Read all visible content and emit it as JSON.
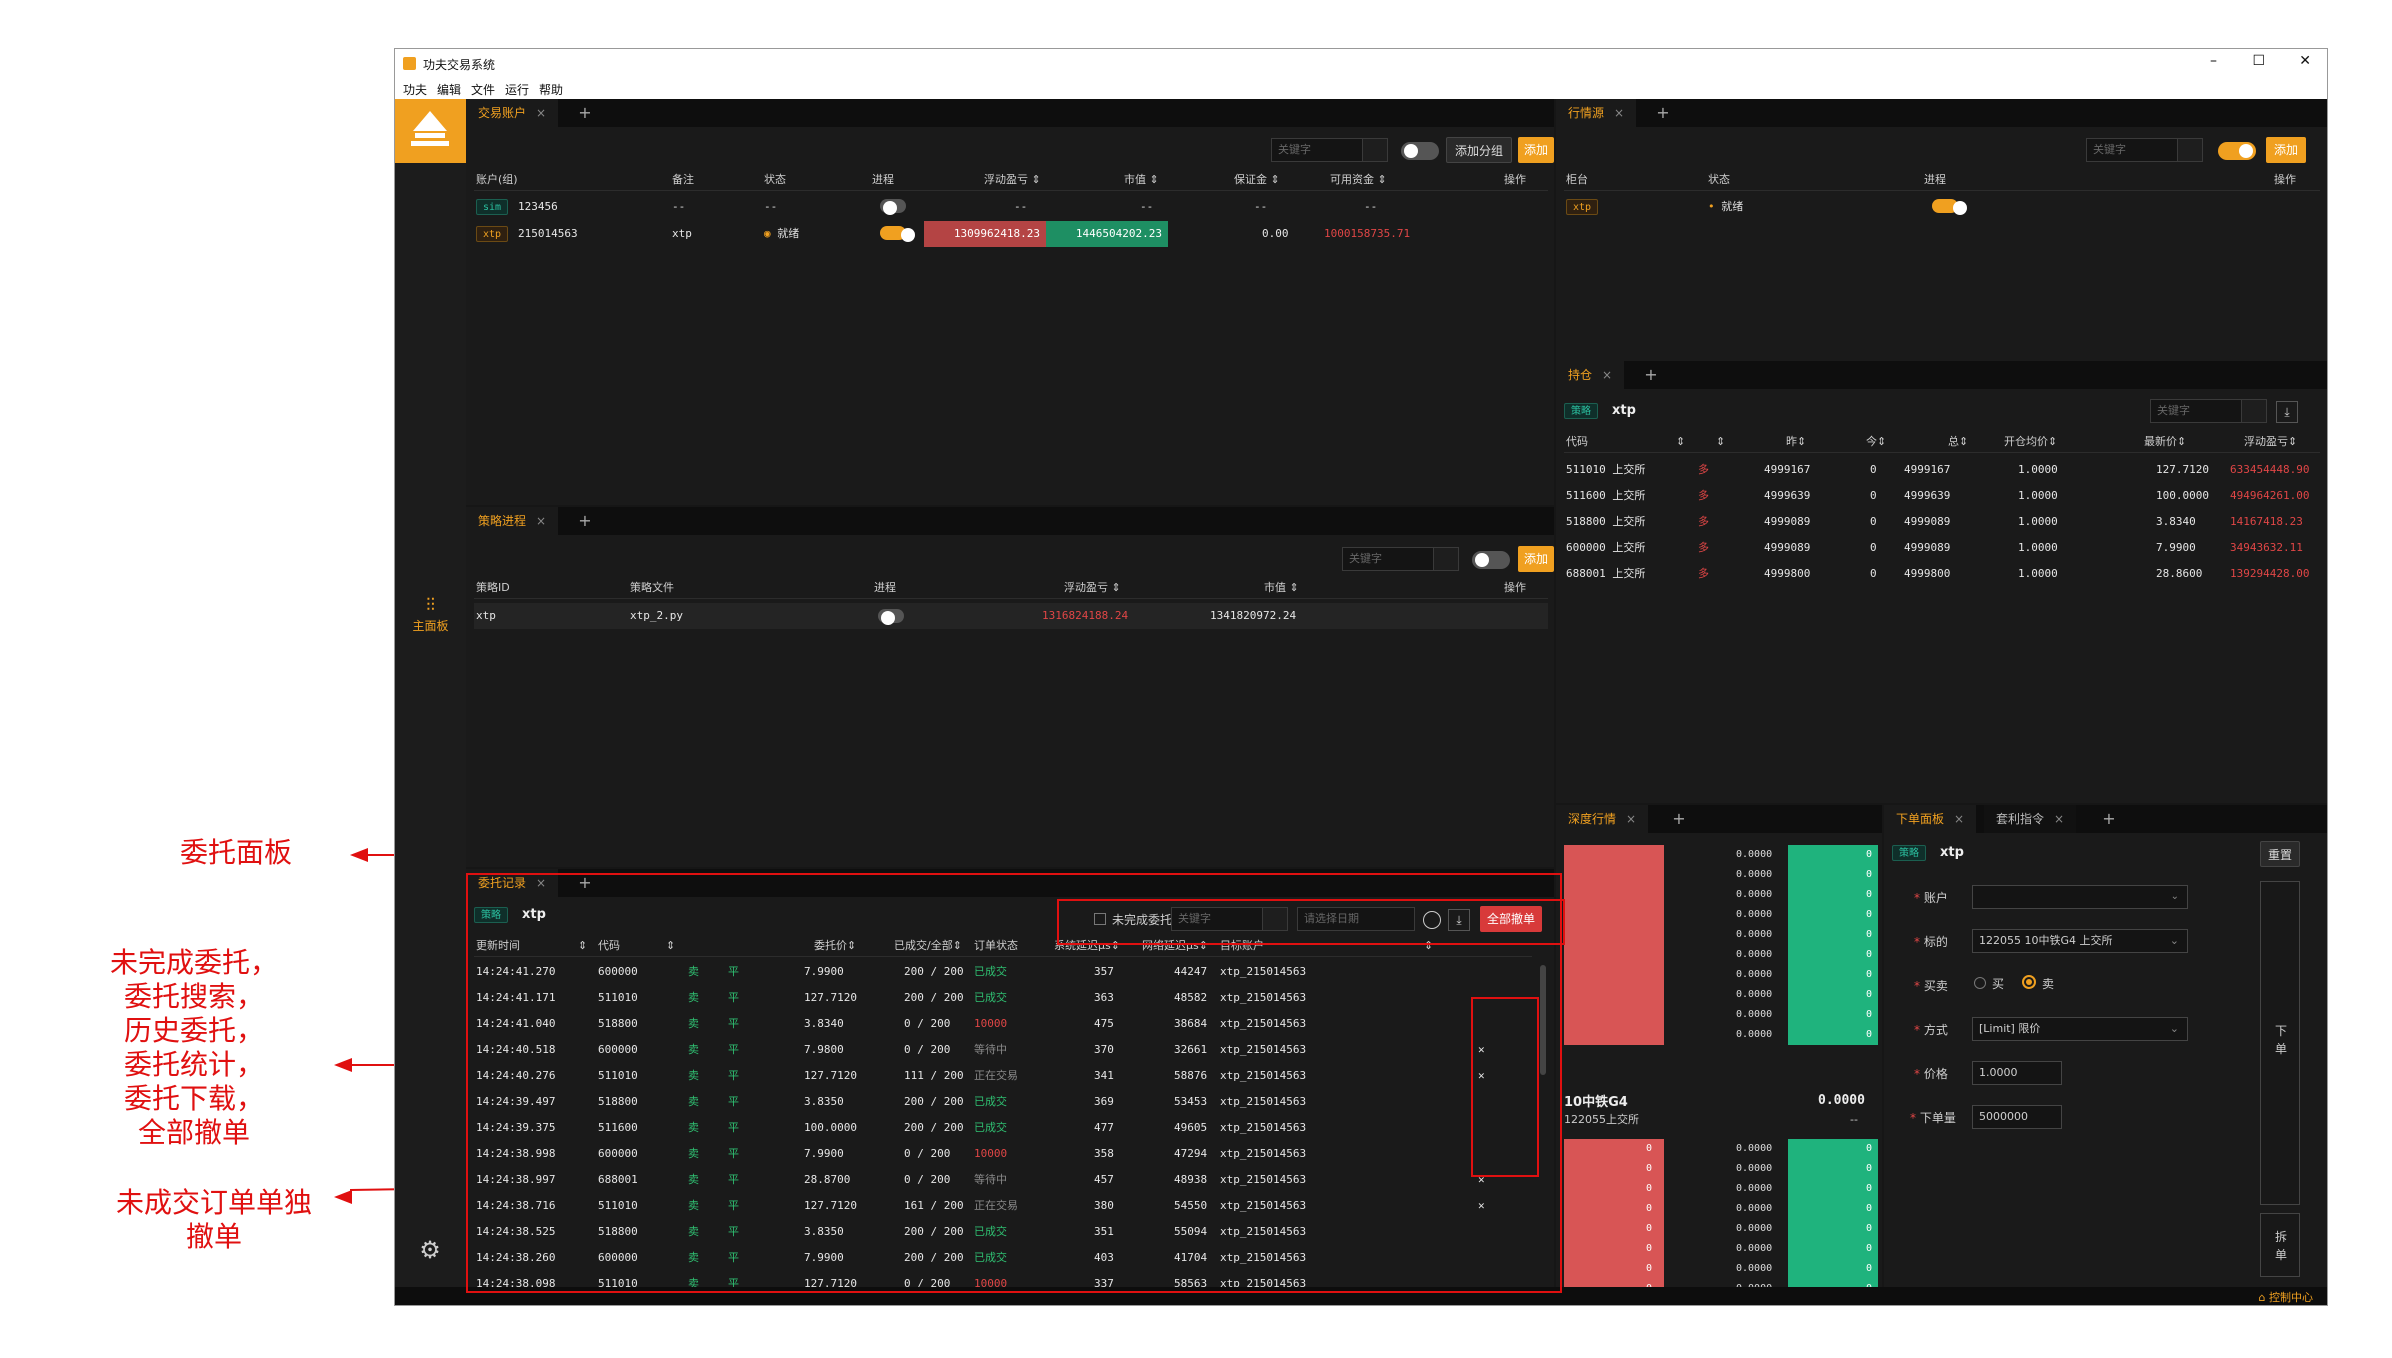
{
  "annotations": {
    "order_panel": "委托面板",
    "functions": [
      "未完成委托，",
      "委托搜索，",
      "历史委托，",
      "委托统计，",
      "委托下载，",
      "全部撤单"
    ],
    "single_cancel": [
      "未成交订单单独",
      "撤单"
    ]
  },
  "window": {
    "title": "功夫交易系统",
    "controls": [
      "–",
      "☐",
      "✕"
    ],
    "menu": [
      "功夫",
      "编辑",
      "文件",
      "运行",
      "帮助"
    ]
  },
  "sidebar": {
    "main_label": "主面板"
  },
  "statusbar": {
    "control_center": "控制中心"
  },
  "accounts": {
    "tab": "交易账户",
    "search_placeholder": "关键字",
    "add_group": "添加分组",
    "add": "添加",
    "headers": [
      "账户(组)",
      "备注",
      "状态",
      "进程",
      "浮动盈亏 ⇕",
      "市值 ⇕",
      "保证金 ⇕",
      "可用资金 ⇕",
      "操作"
    ],
    "rows": [
      {
        "tag": "sim",
        "id": "123456",
        "note": "--",
        "status": "--",
        "pnl": "--",
        "mv": "--",
        "margin": "--",
        "cash": "--"
      },
      {
        "tag": "xtp",
        "id": "215014563",
        "note": "xtp",
        "status": "就绪",
        "pnl": "1309962418.23",
        "mv": "1446504202.23",
        "margin": "0.00",
        "cash": "1000158735.71"
      }
    ]
  },
  "strategies": {
    "tab": "策略进程",
    "search_placeholder": "关键字",
    "add": "添加",
    "headers": [
      "策略ID",
      "策略文件",
      "进程",
      "浮动盈亏 ⇕",
      "市值 ⇕",
      "操作"
    ],
    "rows": [
      {
        "id": "xtp",
        "file": "xtp_2.py",
        "pnl": "1316824188.24",
        "mv": "1341820972.24"
      }
    ]
  },
  "orders": {
    "tab": "委托记录",
    "tag": "策略",
    "account": "xtp",
    "unfinished": "未完成委托",
    "search_placeholder": "关键字",
    "date_placeholder": "请选择日期",
    "cancel_all": "全部撤单",
    "headers": [
      "更新时间",
      "代码",
      "",
      "",
      "委托价⇕",
      "已成交/全部⇕",
      "订单状态",
      "系统延迟μs⇕",
      "网络延迟μs⇕",
      "目标账户"
    ],
    "rows": [
      {
        "time": "14:24:41.270",
        "code": "600000",
        "side": "卖",
        "off": "平",
        "price": "7.9900",
        "fill": "200 / 200",
        "status": "已成交",
        "sys": "357",
        "net": "44247",
        "acct": "xtp_215014563",
        "cancel": ""
      },
      {
        "time": "14:24:41.171",
        "code": "511010",
        "side": "卖",
        "off": "平",
        "price": "127.7120",
        "fill": "200 / 200",
        "status": "已成交",
        "sys": "363",
        "net": "48582",
        "acct": "xtp_215014563",
        "cancel": ""
      },
      {
        "time": "14:24:41.040",
        "code": "518800",
        "side": "卖",
        "off": "平",
        "price": "3.8340",
        "fill": "0 / 200",
        "status": "10000",
        "sys": "475",
        "net": "38684",
        "acct": "xtp_215014563",
        "cancel": ""
      },
      {
        "time": "14:24:40.518",
        "code": "600000",
        "side": "卖",
        "off": "平",
        "price": "7.9800",
        "fill": "0 / 200",
        "status": "等待中",
        "sys": "370",
        "net": "32661",
        "acct": "xtp_215014563",
        "cancel": "✕"
      },
      {
        "time": "14:24:40.276",
        "code": "511010",
        "side": "卖",
        "off": "平",
        "price": "127.7120",
        "fill": "111 / 200",
        "status": "正在交易",
        "sys": "341",
        "net": "58876",
        "acct": "xtp_215014563",
        "cancel": "✕"
      },
      {
        "time": "14:24:39.497",
        "code": "518800",
        "side": "卖",
        "off": "平",
        "price": "3.8350",
        "fill": "200 / 200",
        "status": "已成交",
        "sys": "369",
        "net": "53453",
        "acct": "xtp_215014563",
        "cancel": ""
      },
      {
        "time": "14:24:39.375",
        "code": "511600",
        "side": "卖",
        "off": "平",
        "price": "100.0000",
        "fill": "200 / 200",
        "status": "已成交",
        "sys": "477",
        "net": "49605",
        "acct": "xtp_215014563",
        "cancel": ""
      },
      {
        "time": "14:24:38.998",
        "code": "600000",
        "side": "卖",
        "off": "平",
        "price": "7.9900",
        "fill": "0 / 200",
        "status": "10000",
        "sys": "358",
        "net": "47294",
        "acct": "xtp_215014563",
        "cancel": ""
      },
      {
        "time": "14:24:38.997",
        "code": "688001",
        "side": "卖",
        "off": "平",
        "price": "28.8700",
        "fill": "0 / 200",
        "status": "等待中",
        "sys": "457",
        "net": "48938",
        "acct": "xtp_215014563",
        "cancel": "✕"
      },
      {
        "time": "14:24:38.716",
        "code": "511010",
        "side": "卖",
        "off": "平",
        "price": "127.7120",
        "fill": "161 / 200",
        "status": "正在交易",
        "sys": "380",
        "net": "54550",
        "acct": "xtp_215014563",
        "cancel": "✕"
      },
      {
        "time": "14:24:38.525",
        "code": "518800",
        "side": "卖",
        "off": "平",
        "price": "3.8350",
        "fill": "200 / 200",
        "status": "已成交",
        "sys": "351",
        "net": "55094",
        "acct": "xtp_215014563",
        "cancel": ""
      },
      {
        "time": "14:24:38.260",
        "code": "600000",
        "side": "卖",
        "off": "平",
        "price": "7.9900",
        "fill": "200 / 200",
        "status": "已成交",
        "sys": "403",
        "net": "41704",
        "acct": "xtp_215014563",
        "cancel": ""
      },
      {
        "time": "14:24:38.098",
        "code": "511010",
        "side": "卖",
        "off": "平",
        "price": "127.7120",
        "fill": "0 / 200",
        "status": "10000",
        "sys": "337",
        "net": "58563",
        "acct": "xtp_215014563",
        "cancel": ""
      }
    ]
  },
  "md_source": {
    "tab": "行情源",
    "search_placeholder": "关键字",
    "add": "添加",
    "headers": [
      "柜台",
      "状态",
      "进程",
      "操作"
    ],
    "rows": [
      {
        "tag": "xtp",
        "status": "就绪"
      }
    ]
  },
  "positions": {
    "tab": "持仓",
    "tag": "策略",
    "account": "xtp",
    "search_placeholder": "关键字",
    "headers": [
      "代码",
      "⇕",
      "⇕",
      "昨⇕",
      "今⇕",
      "总⇕",
      "开仓均价⇕",
      "最新价⇕",
      "浮动盈亏⇕"
    ],
    "rows": [
      {
        "code": "511010 上交所",
        "dir": "多",
        "yd": "4999167",
        "td": "0",
        "total": "4999167",
        "avg": "1.0000",
        "last": "127.7120",
        "pnl": "633454448.90"
      },
      {
        "code": "511600 上交所",
        "dir": "多",
        "yd": "4999639",
        "td": "0",
        "total": "4999639",
        "avg": "1.0000",
        "last": "100.0000",
        "pnl": "494964261.00"
      },
      {
        "code": "518800 上交所",
        "dir": "多",
        "yd": "4999089",
        "td": "0",
        "total": "4999089",
        "avg": "1.0000",
        "last": "3.8340",
        "pnl": "14167418.23"
      },
      {
        "code": "600000 上交所",
        "dir": "多",
        "yd": "4999089",
        "td": "0",
        "total": "4999089",
        "avg": "1.0000",
        "last": "7.9900",
        "pnl": "34943632.11"
      },
      {
        "code": "688001 上交所",
        "dir": "多",
        "yd": "4999800",
        "td": "0",
        "total": "4999800",
        "avg": "1.0000",
        "last": "28.8600",
        "pnl": "139294428.00"
      }
    ]
  },
  "depth": {
    "tab": "深度行情",
    "name": "10中铁G4",
    "code": "122055上交所",
    "last": "0.0000",
    "change": "--",
    "ask_prices": [
      "0.0000",
      "0.0000",
      "0.0000",
      "0.0000",
      "0.0000",
      "0.0000",
      "0.0000",
      "0.0000",
      "0.0000",
      "0.0000"
    ],
    "ask_vols": [
      "0",
      "0",
      "0",
      "0",
      "0",
      "0",
      "0",
      "0",
      "0",
      "0"
    ],
    "bid_prices": [
      "0.0000",
      "0.0000",
      "0.0000",
      "0.0000",
      "0.0000",
      "0.0000",
      "0.0000",
      "0.0000",
      "0.0000",
      "0.0000"
    ],
    "bid_vols": [
      "0",
      "0",
      "0",
      "0",
      "0",
      "0",
      "0",
      "0",
      "0",
      "0"
    ]
  },
  "order_form": {
    "tab": "下单面板",
    "tab2": "套利指令",
    "tag": "策略",
    "account": "xtp",
    "reset": "重置",
    "labels": {
      "account": "账户",
      "instrument": "标的",
      "side": "买卖",
      "type": "方式",
      "price": "价格",
      "volume": "下单量"
    },
    "instrument_value": "122055 10中铁G4 上交所",
    "buy": "买",
    "sell": "卖",
    "type_value": "[Limit] 限价",
    "price_value": "1.0000",
    "volume_value": "5000000",
    "place_order": "下单",
    "split_order": "拆单"
  },
  "colors": {
    "accent": "#f0a020",
    "up": "#2fbf71",
    "down": "#e04646",
    "annotation": "#e01010"
  }
}
